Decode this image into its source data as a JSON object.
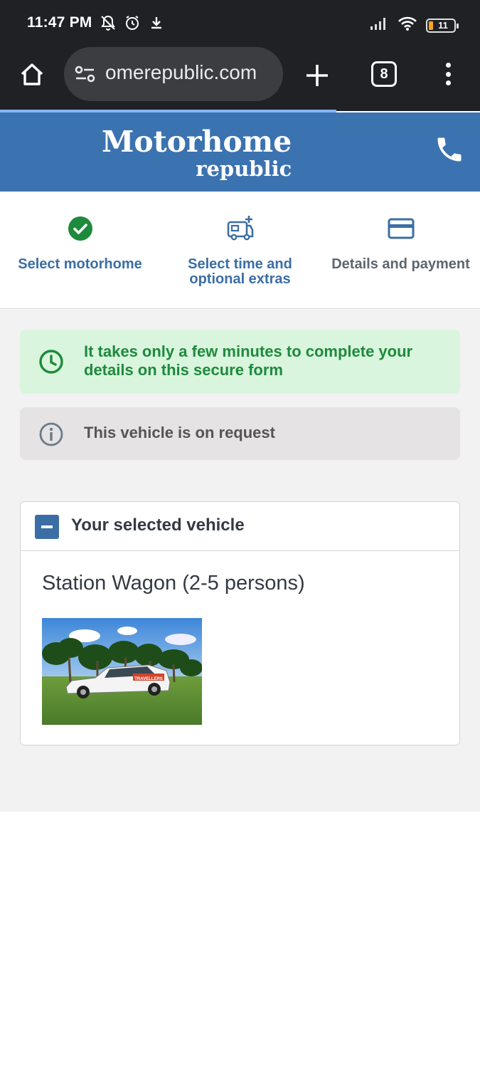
{
  "status_bar": {
    "time": "11:47 PM",
    "battery_level": "11",
    "icons": [
      "notifications-off-icon",
      "alarm-icon",
      "download-icon",
      "signal-icon",
      "wifi-icon",
      "battery-icon"
    ]
  },
  "browser": {
    "url": "omerepublic.com",
    "tab_count": "8",
    "load_progress": 0.7
  },
  "site": {
    "logo_main": "Motorhome",
    "logo_sub": "republic",
    "brand_color": "#3b73b1"
  },
  "steps": [
    {
      "label": "Select motorhome",
      "state": "done",
      "icon": "check-circle-icon"
    },
    {
      "label": "Select time and optional extras",
      "state": "current",
      "icon": "van-plus-icon"
    },
    {
      "label": "Details and payment",
      "state": "upcoming",
      "icon": "credit-card-icon"
    }
  ],
  "alerts": {
    "time_notice": "It takes only a few minutes to complete your details on this secure form",
    "request_notice": "This vehicle is on request"
  },
  "vehicle": {
    "section_title": "Your selected vehicle",
    "name": "Station Wagon (2-5 persons)",
    "car_decal": "TRAVELLERS"
  }
}
